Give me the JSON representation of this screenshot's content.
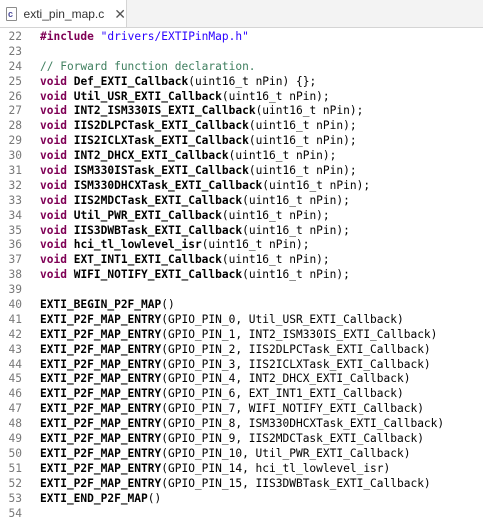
{
  "tab": {
    "icon_letter": "c",
    "title": "exti_pin_map.c",
    "close_glyph": "✕"
  },
  "lines": [
    {
      "n": "22",
      "tokens": [
        {
          "t": "#include",
          "c": "kw"
        },
        {
          "t": " ",
          "c": "plain"
        },
        {
          "t": "\"drivers/EXTIPinMap.h\"",
          "c": "str"
        }
      ]
    },
    {
      "n": "23",
      "tokens": []
    },
    {
      "n": "24",
      "tokens": [
        {
          "t": "// Forward function declaration.",
          "c": "cmt"
        }
      ]
    },
    {
      "n": "25",
      "tokens": [
        {
          "t": "void",
          "c": "kw"
        },
        {
          "t": " ",
          "c": "plain"
        },
        {
          "t": "Def_EXTI_Callback",
          "c": "fn"
        },
        {
          "t": "(uint16_t nPin) {};",
          "c": "plain"
        }
      ]
    },
    {
      "n": "26",
      "tokens": [
        {
          "t": "void",
          "c": "kw"
        },
        {
          "t": " ",
          "c": "plain"
        },
        {
          "t": "Util_USR_EXTI_Callback",
          "c": "fn"
        },
        {
          "t": "(uint16_t nPin);",
          "c": "plain"
        }
      ]
    },
    {
      "n": "27",
      "tokens": [
        {
          "t": "void",
          "c": "kw"
        },
        {
          "t": " ",
          "c": "plain"
        },
        {
          "t": "INT2_ISM330IS_EXTI_Callback",
          "c": "fn"
        },
        {
          "t": "(uint16_t nPin);",
          "c": "plain"
        }
      ]
    },
    {
      "n": "28",
      "tokens": [
        {
          "t": "void",
          "c": "kw"
        },
        {
          "t": " ",
          "c": "plain"
        },
        {
          "t": "IIS2DLPCTask_EXTI_Callback",
          "c": "fn"
        },
        {
          "t": "(uint16_t nPin);",
          "c": "plain"
        }
      ]
    },
    {
      "n": "29",
      "tokens": [
        {
          "t": "void",
          "c": "kw"
        },
        {
          "t": " ",
          "c": "plain"
        },
        {
          "t": "IIS2ICLXTask_EXTI_Callback",
          "c": "fn"
        },
        {
          "t": "(uint16_t nPin);",
          "c": "plain"
        }
      ]
    },
    {
      "n": "30",
      "tokens": [
        {
          "t": "void",
          "c": "kw"
        },
        {
          "t": " ",
          "c": "plain"
        },
        {
          "t": "INT2_DHCX_EXTI_Callback",
          "c": "fn"
        },
        {
          "t": "(uint16_t nPin);",
          "c": "plain"
        }
      ]
    },
    {
      "n": "31",
      "tokens": [
        {
          "t": "void",
          "c": "kw"
        },
        {
          "t": " ",
          "c": "plain"
        },
        {
          "t": "ISM330ISTask_EXTI_Callback",
          "c": "fn"
        },
        {
          "t": "(uint16_t nPin);",
          "c": "plain"
        }
      ]
    },
    {
      "n": "32",
      "tokens": [
        {
          "t": "void",
          "c": "kw"
        },
        {
          "t": " ",
          "c": "plain"
        },
        {
          "t": "ISM330DHCXTask_EXTI_Callback",
          "c": "fn"
        },
        {
          "t": "(uint16_t nPin);",
          "c": "plain"
        }
      ]
    },
    {
      "n": "33",
      "tokens": [
        {
          "t": "void",
          "c": "kw"
        },
        {
          "t": " ",
          "c": "plain"
        },
        {
          "t": "IIS2MDCTask_EXTI_Callback",
          "c": "fn"
        },
        {
          "t": "(uint16_t nPin);",
          "c": "plain"
        }
      ]
    },
    {
      "n": "34",
      "tokens": [
        {
          "t": "void",
          "c": "kw"
        },
        {
          "t": " ",
          "c": "plain"
        },
        {
          "t": "Util_PWR_EXTI_Callback",
          "c": "fn"
        },
        {
          "t": "(uint16_t nPin);",
          "c": "plain"
        }
      ]
    },
    {
      "n": "35",
      "tokens": [
        {
          "t": "void",
          "c": "kw"
        },
        {
          "t": " ",
          "c": "plain"
        },
        {
          "t": "IIS3DWBTask_EXTI_Callback",
          "c": "fn"
        },
        {
          "t": "(uint16_t nPin);",
          "c": "plain"
        }
      ]
    },
    {
      "n": "36",
      "tokens": [
        {
          "t": "void",
          "c": "kw"
        },
        {
          "t": " ",
          "c": "plain"
        },
        {
          "t": "hci_tl_lowlevel_isr",
          "c": "fn"
        },
        {
          "t": "(uint16_t nPin);",
          "c": "plain"
        }
      ]
    },
    {
      "n": "37",
      "tokens": [
        {
          "t": "void",
          "c": "kw"
        },
        {
          "t": " ",
          "c": "plain"
        },
        {
          "t": "EXT_INT1_EXTI_Callback",
          "c": "fn"
        },
        {
          "t": "(uint16_t nPin);",
          "c": "plain"
        }
      ]
    },
    {
      "n": "38",
      "tokens": [
        {
          "t": "void",
          "c": "kw"
        },
        {
          "t": " ",
          "c": "plain"
        },
        {
          "t": "WIFI_NOTIFY_EXTI_Callback",
          "c": "fn"
        },
        {
          "t": "(uint16_t nPin);",
          "c": "plain"
        }
      ]
    },
    {
      "n": "39",
      "tokens": []
    },
    {
      "n": "40",
      "tokens": [
        {
          "t": "EXTI_BEGIN_P2F_MAP",
          "c": "macro"
        },
        {
          "t": "()",
          "c": "plain"
        }
      ]
    },
    {
      "n": "41",
      "tokens": [
        {
          "t": "EXTI_P2F_MAP_ENTRY",
          "c": "macro"
        },
        {
          "t": "(GPIO_PIN_0, Util_USR_EXTI_Callback)",
          "c": "plain"
        }
      ]
    },
    {
      "n": "42",
      "tokens": [
        {
          "t": "EXTI_P2F_MAP_ENTRY",
          "c": "macro"
        },
        {
          "t": "(GPIO_PIN_1, INT2_ISM330IS_EXTI_Callback)",
          "c": "plain"
        }
      ]
    },
    {
      "n": "43",
      "tokens": [
        {
          "t": "EXTI_P2F_MAP_ENTRY",
          "c": "macro"
        },
        {
          "t": "(GPIO_PIN_2, IIS2DLPCTask_EXTI_Callback)",
          "c": "plain"
        }
      ]
    },
    {
      "n": "44",
      "tokens": [
        {
          "t": "EXTI_P2F_MAP_ENTRY",
          "c": "macro"
        },
        {
          "t": "(GPIO_PIN_3, IIS2ICLXTask_EXTI_Callback)",
          "c": "plain"
        }
      ]
    },
    {
      "n": "45",
      "tokens": [
        {
          "t": "EXTI_P2F_MAP_ENTRY",
          "c": "macro"
        },
        {
          "t": "(GPIO_PIN_4, INT2_DHCX_EXTI_Callback)",
          "c": "plain"
        }
      ]
    },
    {
      "n": "46",
      "tokens": [
        {
          "t": "EXTI_P2F_MAP_ENTRY",
          "c": "macro"
        },
        {
          "t": "(GPIO_PIN_6, EXT_INT1_EXTI_Callback)",
          "c": "plain"
        }
      ]
    },
    {
      "n": "47",
      "tokens": [
        {
          "t": "EXTI_P2F_MAP_ENTRY",
          "c": "macro"
        },
        {
          "t": "(GPIO_PIN_7, WIFI_NOTIFY_EXTI_Callback)",
          "c": "plain"
        }
      ]
    },
    {
      "n": "48",
      "tokens": [
        {
          "t": "EXTI_P2F_MAP_ENTRY",
          "c": "macro"
        },
        {
          "t": "(GPIO_PIN_8, ISM330DHCXTask_EXTI_Callback)",
          "c": "plain"
        }
      ]
    },
    {
      "n": "49",
      "tokens": [
        {
          "t": "EXTI_P2F_MAP_ENTRY",
          "c": "macro"
        },
        {
          "t": "(GPIO_PIN_9, IIS2MDCTask_EXTI_Callback)",
          "c": "plain"
        }
      ]
    },
    {
      "n": "50",
      "tokens": [
        {
          "t": "EXTI_P2F_MAP_ENTRY",
          "c": "macro"
        },
        {
          "t": "(GPIO_PIN_10, Util_PWR_EXTI_Callback)",
          "c": "plain"
        }
      ]
    },
    {
      "n": "51",
      "tokens": [
        {
          "t": "EXTI_P2F_MAP_ENTRY",
          "c": "macro"
        },
        {
          "t": "(GPIO_PIN_14, hci_tl_lowlevel_isr)",
          "c": "plain"
        }
      ]
    },
    {
      "n": "52",
      "tokens": [
        {
          "t": "EXTI_P2F_MAP_ENTRY",
          "c": "macro"
        },
        {
          "t": "(GPIO_PIN_15, IIS3DWBTask_EXTI_Callback)",
          "c": "plain"
        }
      ]
    },
    {
      "n": "53",
      "tokens": [
        {
          "t": "EXTI_END_P2F_MAP",
          "c": "macro"
        },
        {
          "t": "()",
          "c": "plain"
        }
      ]
    },
    {
      "n": "54",
      "tokens": []
    }
  ]
}
